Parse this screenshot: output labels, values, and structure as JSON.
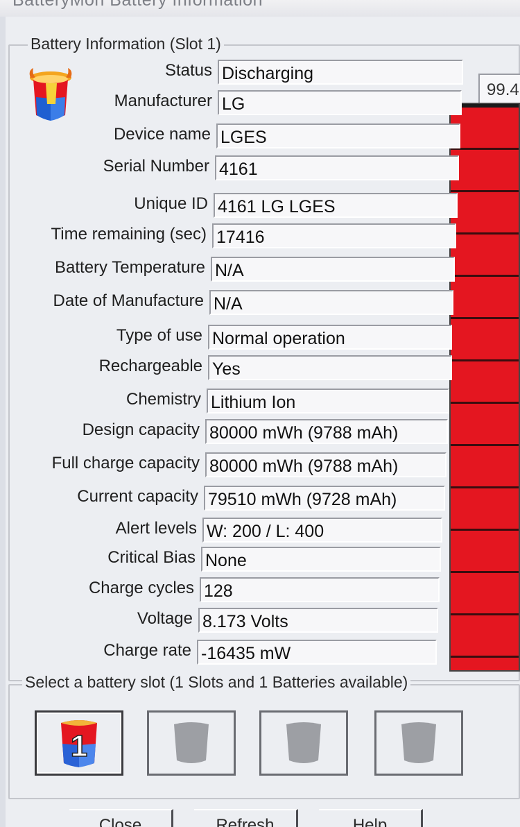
{
  "window": {
    "title": "BatteryMon Battery Information"
  },
  "info_group": {
    "title": "Battery Information (Slot 1)"
  },
  "fields": [
    {
      "label": "Status",
      "value": "Discharging"
    },
    {
      "label": "Manufacturer",
      "value": "LG"
    },
    {
      "label": "Device name",
      "value": "LGES"
    },
    {
      "label": "Serial Number",
      "value": "4161"
    },
    {
      "label": "Unique ID",
      "value": "4161 LG LGES"
    },
    {
      "label": "Time remaining (sec)",
      "value": "17416"
    },
    {
      "label": "Battery Temperature",
      "value": "N/A"
    },
    {
      "label": "Date of Manufacture",
      "value": "N/A"
    },
    {
      "label": "Type of use",
      "value": "Normal operation"
    },
    {
      "label": "Rechargeable",
      "value": "Yes"
    },
    {
      "label": "Chemistry",
      "value": "Lithium Ion"
    },
    {
      "label": "Design capacity",
      "value": "80000 mWh (9788 mAh)"
    },
    {
      "label": "Full charge capacity",
      "value": "80000 mWh (9788 mAh)"
    },
    {
      "label": "Current capacity",
      "value": "79510 mWh (9728 mAh)"
    },
    {
      "label": "Alert levels",
      "value": "W: 200 / L: 400"
    },
    {
      "label": "Critical Bias",
      "value": "None"
    },
    {
      "label": "Charge cycles",
      "value": "128"
    },
    {
      "label": "Voltage",
      "value": "8.173 Volts"
    },
    {
      "label": "Charge rate",
      "value": "-16435 mW"
    }
  ],
  "charge_gauge": {
    "percent_text": "99.4",
    "level_percent": 99.4,
    "fill_color": "#e41620"
  },
  "slot_group": {
    "title": "Select a battery slot (1 Slots and 1 Batteries available)",
    "slots": [
      {
        "number": "1",
        "active": true,
        "icon": "battery-slot-1-icon"
      },
      {
        "number": "",
        "active": false,
        "icon": "empty-battery-slot-icon"
      },
      {
        "number": "",
        "active": false,
        "icon": "empty-battery-slot-icon"
      },
      {
        "number": "",
        "active": false,
        "icon": "empty-battery-slot-icon"
      }
    ]
  },
  "buttons": {
    "close": "Close",
    "refresh": "Refresh",
    "help": "Help"
  }
}
